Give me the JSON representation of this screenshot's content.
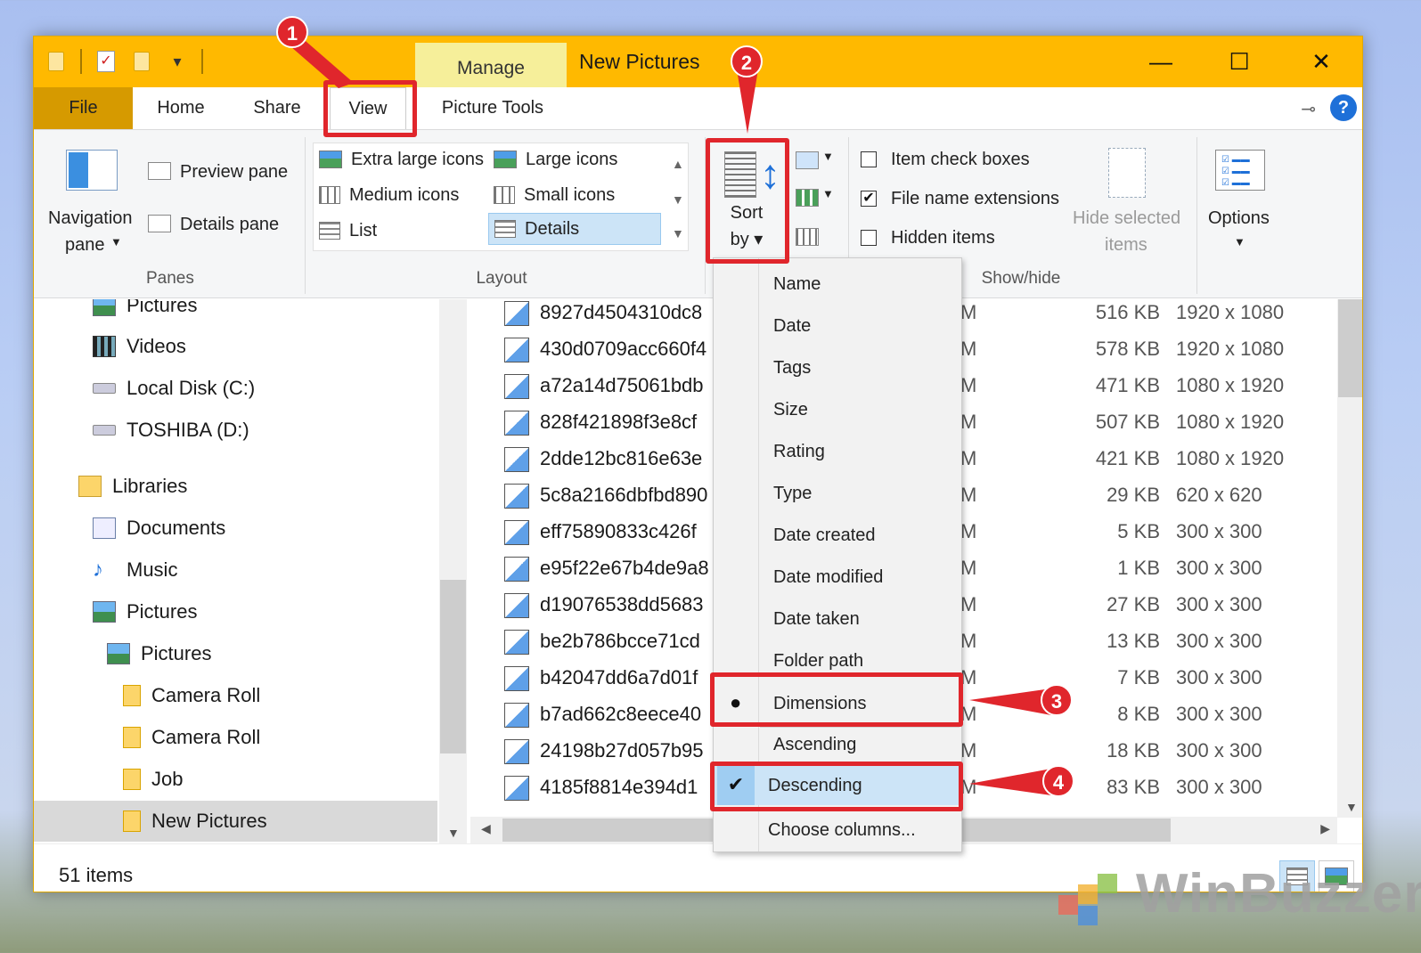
{
  "window": {
    "title": "New Pictures",
    "manage_tab": "Manage",
    "minimize": "—",
    "maximize": "☐",
    "close": "✕"
  },
  "tabs": {
    "file": "File",
    "home": "Home",
    "share": "Share",
    "view": "View",
    "picture_tools": "Picture Tools"
  },
  "ribbon": {
    "panes": {
      "navigation_pane_line1": "Navigation",
      "navigation_pane_line2": "pane",
      "preview_pane": "Preview pane",
      "details_pane": "Details pane",
      "label": "Panes"
    },
    "layout": {
      "extra_large_icons": "Extra large icons",
      "large_icons": "Large icons",
      "medium_icons": "Medium icons",
      "small_icons": "Small icons",
      "list": "List",
      "details": "Details",
      "label": "Layout"
    },
    "sort_by_line1": "Sort",
    "sort_by_line2": "by",
    "show_hide": {
      "item_check_boxes": "Item check boxes",
      "file_name_extensions": "File name extensions",
      "hidden_items": "Hidden items",
      "hide_selected_line1": "Hide selected",
      "hide_selected_line2": "items",
      "label": "Show/hide"
    },
    "options": "Options"
  },
  "nav": {
    "items": [
      {
        "label": "Pictures"
      },
      {
        "label": "Videos"
      },
      {
        "label": "Local Disk (C:)"
      },
      {
        "label": "TOSHIBA (D:)"
      },
      {
        "label": "Libraries"
      },
      {
        "label": "Documents"
      },
      {
        "label": "Music"
      },
      {
        "label": "Pictures"
      },
      {
        "label": "Pictures"
      },
      {
        "label": "Camera Roll"
      },
      {
        "label": "Camera Roll"
      },
      {
        "label": "Job"
      },
      {
        "label": "New Pictures"
      }
    ]
  },
  "files": {
    "rows": [
      {
        "name": "8927d4504310dc8",
        "m": "M",
        "size": "516 KB",
        "dims": "1920 x 1080"
      },
      {
        "name": "430d0709acc660f4",
        "m": "M",
        "size": "578 KB",
        "dims": "1920 x 1080"
      },
      {
        "name": "a72a14d75061bdb",
        "m": "M",
        "size": "471 KB",
        "dims": "1080 x 1920"
      },
      {
        "name": "828f421898f3e8cf",
        "m": "M",
        "size": "507 KB",
        "dims": "1080 x 1920"
      },
      {
        "name": "2dde12bc816e63e",
        "m": "M",
        "size": "421 KB",
        "dims": "1080 x 1920"
      },
      {
        "name": "5c8a2166dbfbd890",
        "m": "M",
        "size": "29 KB",
        "dims": "620 x 620"
      },
      {
        "name": "eff75890833c426f",
        "m": "M",
        "size": "5 KB",
        "dims": "300 x 300"
      },
      {
        "name": "e95f22e67b4de9a8",
        "m": "M",
        "size": "1 KB",
        "dims": "300 x 300"
      },
      {
        "name": "d19076538dd5683",
        "m": "M",
        "size": "27 KB",
        "dims": "300 x 300"
      },
      {
        "name": "be2b786bcce71cd",
        "m": "M",
        "size": "13 KB",
        "dims": "300 x 300"
      },
      {
        "name": "b42047dd6a7d01f",
        "m": "M",
        "size": "7 KB",
        "dims": "300 x 300"
      },
      {
        "name": "b7ad662c8eece40",
        "m": "M",
        "size": "8 KB",
        "dims": "300 x 300"
      },
      {
        "name": "24198b27d057b95",
        "m": "M",
        "size": "18 KB",
        "dims": "300 x 300"
      },
      {
        "name": "4185f8814e394d1",
        "m": "M",
        "size": "83 KB",
        "dims": "300 x 300"
      }
    ]
  },
  "sort_menu": {
    "items": [
      {
        "label": "Name"
      },
      {
        "label": "Date"
      },
      {
        "label": "Tags"
      },
      {
        "label": "Size"
      },
      {
        "label": "Rating"
      },
      {
        "label": "Type"
      },
      {
        "label": "Date created"
      },
      {
        "label": "Date modified"
      },
      {
        "label": "Date taken"
      },
      {
        "label": "Folder path"
      },
      {
        "label": "Dimensions",
        "mark": "●"
      },
      {
        "label": "Ascending"
      },
      {
        "label": "Descending",
        "mark": "✔"
      },
      {
        "label": "Choose columns..."
      }
    ]
  },
  "status": {
    "count": "51 items"
  },
  "annotations": {
    "step1": "1",
    "step2": "2",
    "step3": "3",
    "step4": "4"
  },
  "watermark": "WinBuzzer",
  "colors": {
    "titlebar": "#ffb900",
    "file_tab": "#d69a00",
    "highlight": "#e0262c",
    "selection": "#cce4f7"
  }
}
